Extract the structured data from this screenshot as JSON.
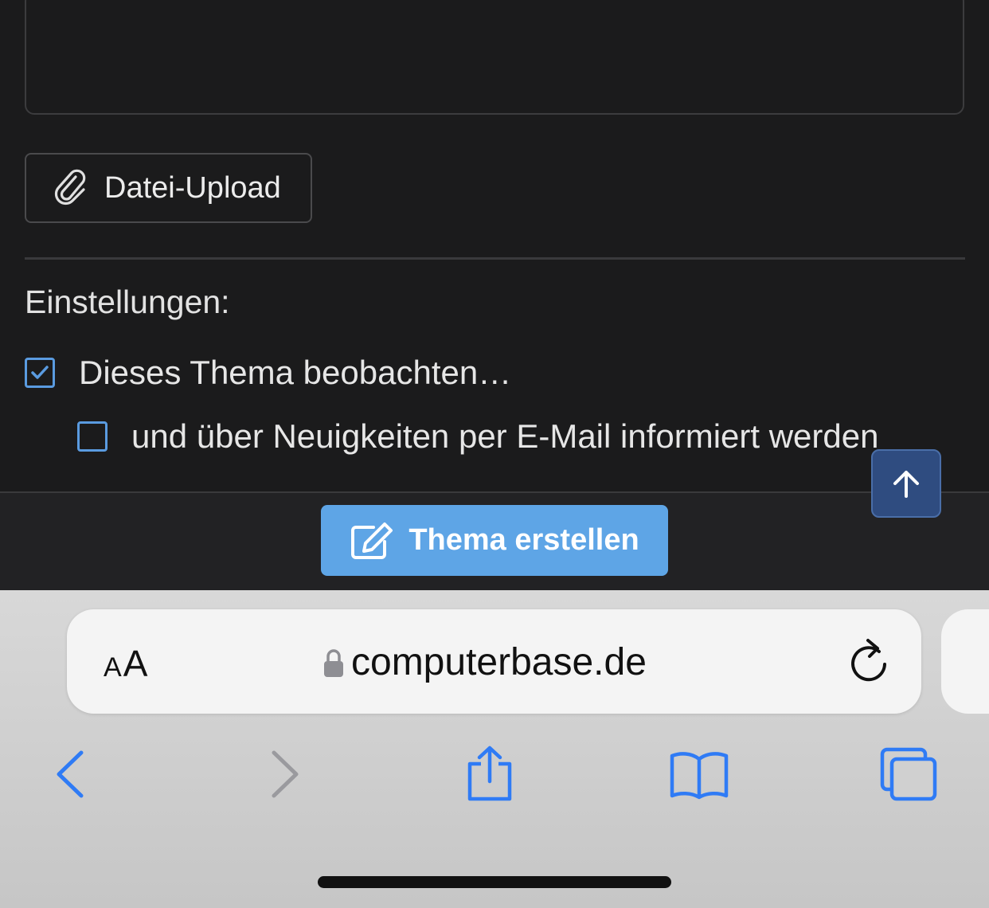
{
  "form": {
    "upload_label": "Datei-Upload",
    "settings_title": "Einstellungen:",
    "watch_label": "Dieses Thema beobachten…",
    "watch_checked": true,
    "email_label": "und über Neuigkeiten per E-Mail informiert werden",
    "email_checked": false
  },
  "actions": {
    "create_label": "Thema erstellen"
  },
  "browser": {
    "aa_small": "A",
    "aa_large": "A",
    "url": "computerbase.de"
  },
  "colors": {
    "accent": "#5ea5e6",
    "checkbox": "#5a9be0",
    "scroll_top": "#2f4c80",
    "safari_blue": "#2f7bf5"
  },
  "icons": {
    "upload": "paperclip-icon",
    "create": "edit-icon",
    "scroll_top": "arrow-up-icon",
    "lock": "lock-icon",
    "reload": "reload-icon",
    "back": "chevron-left-icon",
    "forward": "chevron-right-icon",
    "share": "share-icon",
    "bookmarks": "book-icon",
    "tabs": "tabs-icon"
  }
}
